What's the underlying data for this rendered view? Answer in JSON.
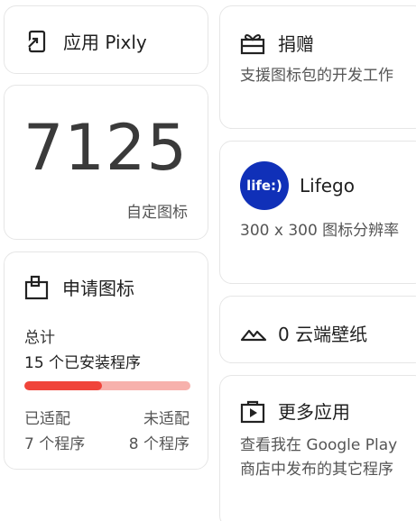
{
  "cards": {
    "app": {
      "title": "应用 Pixly",
      "icon": "open-in-app-icon"
    },
    "icons": {
      "count": "7125",
      "caption": "自定图标"
    },
    "request": {
      "title": "申请图标",
      "icon": "request-icon",
      "total_label": "总计",
      "total_value": "15 个已安装程序",
      "progress_fraction": 0.467,
      "progress_color": "#f0443a",
      "progress_track_color": "#f7b1ac",
      "themed_label": "已适配",
      "themed_value": "7 个程序",
      "unthemed_label": "未适配",
      "unthemed_value": "8 个程序"
    },
    "donate": {
      "title": "捐赠",
      "icon": "gift-icon",
      "desc": "支援图标包的开发工作"
    },
    "lifego": {
      "logo_text": "life:)",
      "title": "Lifego",
      "desc": "300 x 300 图标分辨率",
      "logo_color": "#1030b8"
    },
    "wallpapers": {
      "title": "0 云端壁纸",
      "icon": "landscape-icon"
    },
    "more_apps": {
      "title": "更多应用",
      "icon": "play-store-icon",
      "desc": "查看我在 Google Play 商店中发布的其它程序"
    }
  }
}
